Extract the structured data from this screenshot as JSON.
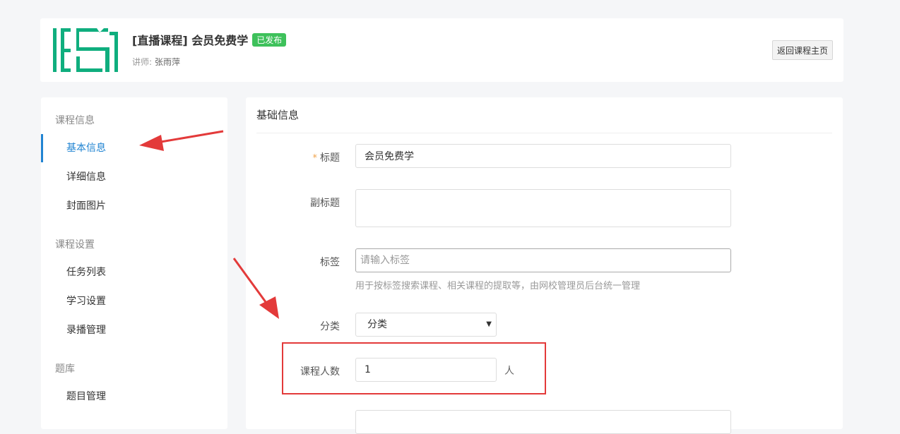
{
  "header": {
    "course_title": "[直播课程] 会员免费学",
    "status": "已发布",
    "teacher_label": "讲师:",
    "teacher_name": "张雨萍",
    "back_button": "返回课程主页",
    "brand_color": "#0fae7e",
    "status_color": "#3ec15b"
  },
  "sidebar": {
    "groups": [
      {
        "title": "课程信息",
        "items": [
          "基本信息",
          "详细信息",
          "封面图片"
        ]
      },
      {
        "title": "课程设置",
        "items": [
          "任务列表",
          "学习设置",
          "录播管理"
        ]
      },
      {
        "title": "题库",
        "items": [
          "题目管理"
        ]
      }
    ],
    "active_item": "基本信息",
    "active_color": "#2184d2"
  },
  "form": {
    "section_title": "基础信息",
    "title_label": "标题",
    "title_value": "会员免费学",
    "subtitle_label": "副标题",
    "subtitle_value": "",
    "tags_label": "标签",
    "tags_placeholder": "请输入标签",
    "tags_help": "用于按标签搜索课程、相关课程的提取等，由网校管理员后台统一管理",
    "category_label": "分类",
    "category_value": "分类",
    "students_label": "课程人数",
    "students_value": "1",
    "students_unit": "人"
  },
  "annotation_color": "#e33a3a"
}
